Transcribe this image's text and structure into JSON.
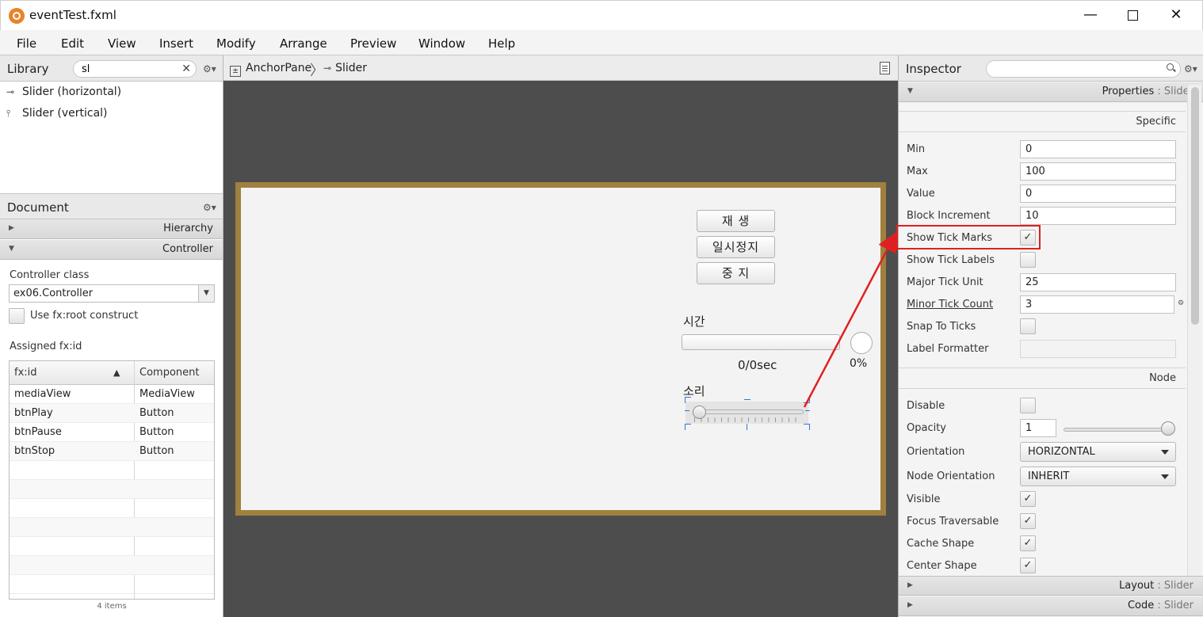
{
  "window": {
    "title": "eventTest.fxml",
    "minimize": "—",
    "close": "✕"
  },
  "menu": [
    "File",
    "Edit",
    "View",
    "Insert",
    "Modify",
    "Arrange",
    "Preview",
    "Window",
    "Help"
  ],
  "library": {
    "title": "Library",
    "search_value": "sl",
    "clear": "✕",
    "gear": "⚙▾",
    "items": [
      {
        "icon": "⊸",
        "label": "Slider  (horizontal)"
      },
      {
        "icon": "⫯",
        "label": "Slider  (vertical)"
      }
    ]
  },
  "document": {
    "title": "Document",
    "gear": "⚙▾",
    "sections": [
      {
        "label": "Hierarchy",
        "expanded": false
      },
      {
        "label": "Controller",
        "expanded": true
      }
    ],
    "controller_class_label": "Controller class",
    "controller_class_value": "ex06.Controller",
    "use_fx_root_label": "Use fx:root construct",
    "assigned_label": "Assigned fx:id",
    "table": {
      "col1": "fx:id",
      "col2": "Component",
      "sort": "▲",
      "rows": [
        {
          "id": "mediaView",
          "component": "MediaView"
        },
        {
          "id": "btnPlay",
          "component": "Button"
        },
        {
          "id": "btnPause",
          "component": "Button"
        },
        {
          "id": "btnStop",
          "component": "Button"
        }
      ]
    },
    "items_count": "4 items"
  },
  "breadcrumb": {
    "items": [
      "AnchorPane",
      "Slider"
    ],
    "sep": "〉"
  },
  "stage": {
    "btn_play": "재    생",
    "btn_pause": "일시정지",
    "btn_stop": "중    지",
    "time_label": "시간",
    "time_text": "0/0sec",
    "progress_text": "0%",
    "progress": 0,
    "volume_label": "소리",
    "volume": 0
  },
  "inspector": {
    "title": "Inspector",
    "gear": "⚙▾",
    "properties_section": {
      "name": "Properties",
      "sub": "Slider"
    },
    "specific_title": "Specific",
    "node_title": "Node",
    "specific": {
      "min_label": "Min",
      "min": "0",
      "max_label": "Max",
      "max": "100",
      "value_label": "Value",
      "value": "0",
      "block_label": "Block Increment",
      "block": "10",
      "show_ticks_label": "Show Tick Marks",
      "show_ticks": true,
      "show_tick_labels_label": "Show Tick Labels",
      "show_tick_labels": false,
      "major_label": "Major Tick Unit",
      "major": "25",
      "minor_label": "Minor Tick Count",
      "minor": "3",
      "snap_label": "Snap To Ticks",
      "snap": false,
      "formatter_label": "Label Formatter",
      "formatter": ""
    },
    "node": {
      "disable_label": "Disable",
      "disable": false,
      "opacity_label": "Opacity",
      "opacity": "1",
      "opacity_level": 1.0,
      "orientation_label": "Orientation",
      "orientation": "HORIZONTAL",
      "node_orientation_label": "Node Orientation",
      "node_orientation": "INHERIT",
      "visible_label": "Visible",
      "visible": true,
      "focus_label": "Focus Traversable",
      "focus": true,
      "cache_label": "Cache Shape",
      "cache": true,
      "center_label": "Center Shape",
      "center": true
    },
    "layout_section": {
      "name": "Layout",
      "sub": "Slider"
    },
    "code_section": {
      "name": "Code",
      "sub": "Slider"
    }
  },
  "colors": {
    "highlight": "#e02020",
    "stage_border": "#a0803f",
    "canvas_bg": "#4d4d4d",
    "selection": "#2f78d3"
  }
}
